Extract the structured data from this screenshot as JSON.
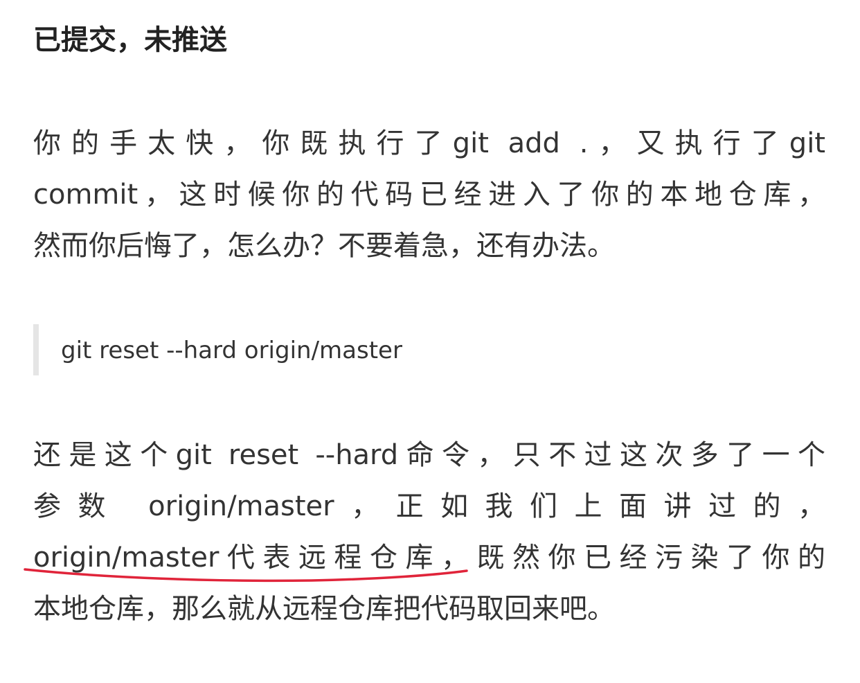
{
  "heading": "已提交，未推送",
  "paragraph1": [
    "你的手太快，你既执行了git add .，又执行了git",
    "commit，这时候你的代码已经进入了你的本地仓库，",
    "然而你后悔了，怎么办？不要着急，还有办法。"
  ],
  "quote": "git reset --hard origin/master",
  "paragraph2": [
    "还是这个git reset --hard命令，只不过这次多了一个",
    "参数 origin/master，正如我们上面讲过的，",
    "origin/master代表远程仓库，既然你已经污染了你的",
    "本地仓库，那么就从远程仓库把代码取回来吧。"
  ],
  "colors": {
    "text": "#333333",
    "quote_border": "#e5e5e5",
    "annotation": "#e0243a"
  }
}
